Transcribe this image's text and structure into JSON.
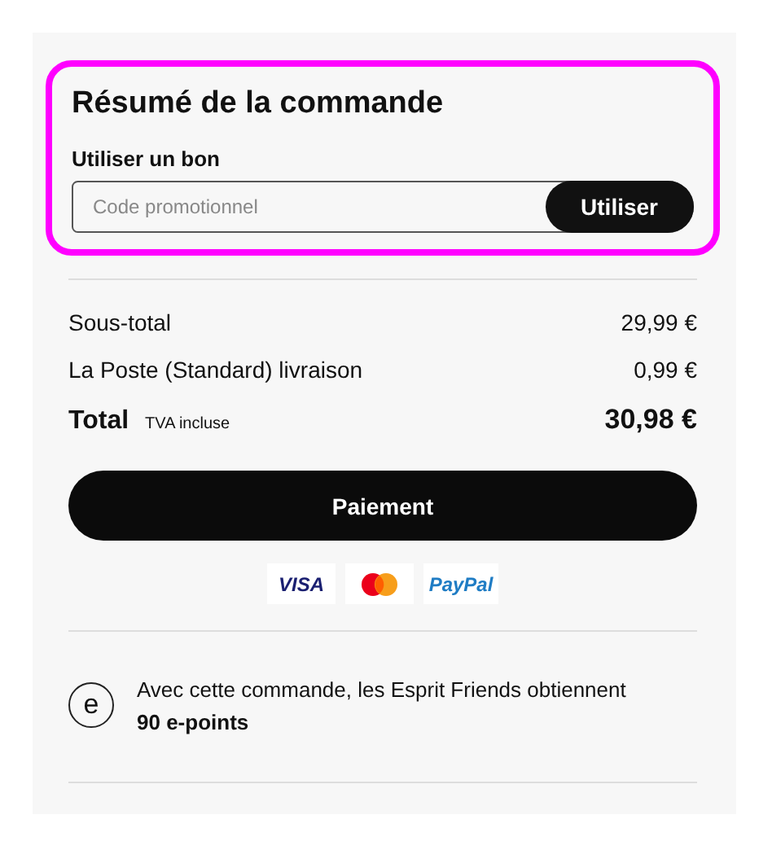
{
  "voucher_section": {
    "title": "Résumé de la commande",
    "highlighted": true,
    "label": "Utiliser un bon",
    "field": {
      "placeholder": "Code promotionnel"
    },
    "button": "Utiliser"
  },
  "lines": [
    {
      "kind": "normal",
      "label": "Sous-total",
      "amount": "29,99 €"
    },
    {
      "kind": "normal",
      "label": "La Poste (Standard) livraison",
      "amount": "0,99 €"
    },
    {
      "kind": "total",
      "label": "Total",
      "note": "TVA incluse",
      "amount": "30,98 €"
    }
  ],
  "checkout_button": "Paiement",
  "payment_methods": [
    {
      "kind": "visa",
      "text": "VISA"
    },
    {
      "kind": "mastercard"
    },
    {
      "kind": "paypal",
      "text": "PayPal"
    }
  ],
  "loyalty": {
    "icon": "e",
    "text": "Avec cette commande, les Esprit Friends obtiennent",
    "points": "90 e-points"
  }
}
